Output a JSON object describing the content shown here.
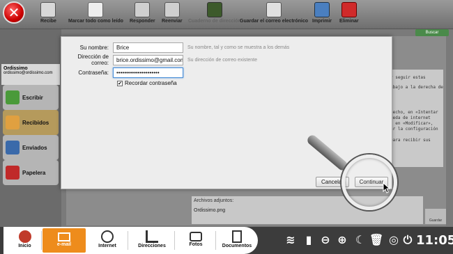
{
  "toolbar": {
    "receive": "Recibe",
    "mark_all_read": "Marcar todo como leído",
    "reply": "Responder",
    "forward": "Reenviar",
    "address_book": "Cuaderno de dirección",
    "save_email": "Guardar el correo electrónico",
    "print": "Imprimir",
    "delete": "Eliminar"
  },
  "search_label": "Buscar",
  "account": {
    "name": "Ordissimo",
    "email": "ordissimo@ordissimo.com"
  },
  "folders": [
    {
      "label": "Escribir"
    },
    {
      "label": "Recibidos"
    },
    {
      "label": "Enviados"
    },
    {
      "label": "Papelera"
    }
  ],
  "reading_lines": [
    "y seguir estas",
    "abajo a la derecha de",
    "hecho, en «Intentar",
    "ueda de internet",
    "s en «Modificar»,",
    "ar la configuración",
    "para recibir sus"
  ],
  "attachments": {
    "title": "Archivos adjuntos:",
    "file": "Ordissimo.png",
    "save_label": "Guardar"
  },
  "dialog": {
    "name_label": "Su nombre:",
    "name_value": "Brice",
    "name_hint": "Su nombre, tal y como se muestra a los demás",
    "email_label": "Dirección de correo:",
    "email_value": "brice.ordissimo@gmail.com",
    "email_hint": "Su dirección de correo existente",
    "password_label": "Contraseña:",
    "password_value": "••••••••••••••••••••••",
    "remember_label": "Recordar contraseña",
    "remember_checked": "✔",
    "cancel_label": "Cancelar",
    "continue_label": "Continuar"
  },
  "taskbar": {
    "tabs": [
      {
        "label": "Inicio"
      },
      {
        "label": "e-mail"
      },
      {
        "label": "Internet"
      },
      {
        "label": "Direcciones"
      },
      {
        "label": "Fotos"
      },
      {
        "label": "Documentos"
      }
    ],
    "clock": "11:05"
  },
  "colors": {
    "accent": "#ee8c1c",
    "focus": "#4a8fd8",
    "close": "#cc0000"
  }
}
